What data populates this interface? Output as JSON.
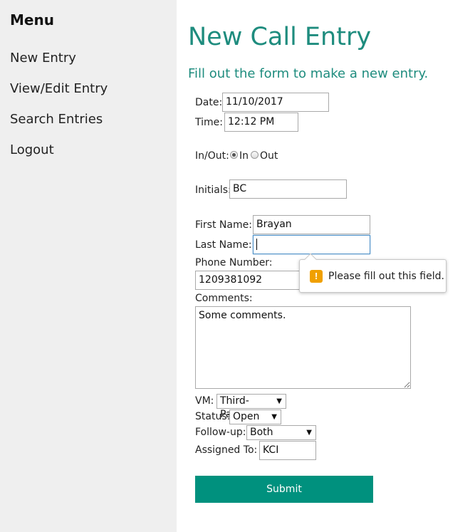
{
  "sidebar": {
    "title": "Menu",
    "items": [
      {
        "label": "New Entry"
      },
      {
        "label": "View/Edit Entry"
      },
      {
        "label": "Search Entries"
      },
      {
        "label": "Logout"
      }
    ]
  },
  "page": {
    "title": "New Call Entry",
    "subtitle": "Fill out the form to make a new entry."
  },
  "form": {
    "date": {
      "label": "Date:",
      "value": "11/10/2017"
    },
    "time": {
      "label": "Time:",
      "value": "12:12 PM"
    },
    "inout": {
      "label": "In/Out:",
      "options": [
        "In",
        "Out"
      ],
      "selected": "In"
    },
    "initials": {
      "label": "Initials:",
      "value": "BC"
    },
    "first_name": {
      "label": "First Name:",
      "value": "Brayan"
    },
    "last_name": {
      "label": "Last Name:",
      "value": ""
    },
    "phone": {
      "label": "Phone Number:",
      "value": "1209381092"
    },
    "comments": {
      "label": "Comments:",
      "value": "Some comments."
    },
    "vm": {
      "label": "VM:",
      "value": "Third-Party"
    },
    "status": {
      "label": "Status:",
      "value": "Open"
    },
    "followup": {
      "label": "Follow-up:",
      "value": "Both"
    },
    "assigned": {
      "label": "Assigned To:",
      "value": "KCI"
    },
    "submit_label": "Submit"
  },
  "validation_tooltip": {
    "message": "Please fill out this field.",
    "icon": "warning-icon",
    "icon_glyph": "!"
  },
  "colors": {
    "accent": "#1e8c7e",
    "submit_bg": "#00917e",
    "sidebar_bg": "#efefef",
    "warning": "#f0a000"
  }
}
